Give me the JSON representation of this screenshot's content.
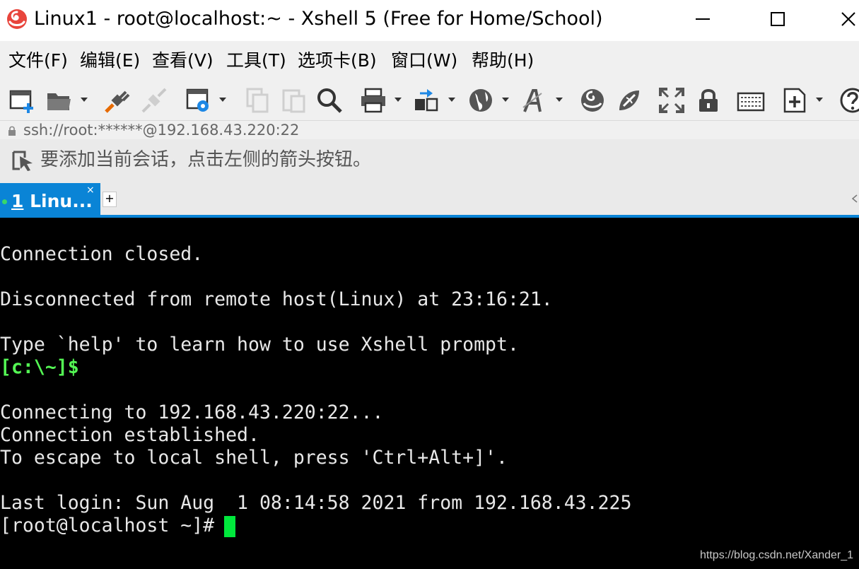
{
  "window": {
    "title": "Linux1 - root@localhost:~ - Xshell 5 (Free for Home/School)",
    "close_glyph": "✕"
  },
  "menu": {
    "items": [
      {
        "label": "文件(F)"
      },
      {
        "label": "编辑(E)"
      },
      {
        "label": "查看(V)"
      },
      {
        "label": "工具(T)"
      },
      {
        "label": "选项卡(B)"
      },
      {
        "label": "窗口(W)"
      },
      {
        "label": "帮助(H)"
      }
    ]
  },
  "toolbar": {
    "icons": [
      "new-session-icon",
      "open-folder-icon",
      "connect-icon",
      "disconnect-icon",
      "properties-icon",
      "copy-icon",
      "paste-icon",
      "find-icon",
      "print-icon",
      "transfer-icon",
      "globe-icon",
      "font-icon",
      "xshell-logo-icon",
      "xftp-icon",
      "fullscreen-icon",
      "lock-icon",
      "keyboard-icon",
      "compose-icon",
      "help-icon"
    ]
  },
  "address": {
    "value": "ssh://root:******@192.168.43.220:22"
  },
  "hint": {
    "text": "要添加当前会话，点击左侧的箭头按钮。"
  },
  "tabs": {
    "active": {
      "number": "1",
      "label": " Linu..."
    },
    "close_glyph": "×",
    "add_glyph": "+"
  },
  "terminal": {
    "lines": [
      {
        "text": ""
      },
      {
        "text": "Connection closed."
      },
      {
        "text": ""
      },
      {
        "text": "Disconnected from remote host(Linux) at 23:16:21."
      },
      {
        "text": ""
      },
      {
        "text": "Type `help' to learn how to use Xshell prompt."
      },
      {
        "text": "[c:\\~]$"
      },
      {
        "text": ""
      },
      {
        "text": "Connecting to 192.168.43.220:22..."
      },
      {
        "text": "Connection established."
      },
      {
        "text": "To escape to local shell, press 'Ctrl+Alt+]'."
      },
      {
        "text": ""
      },
      {
        "text": "Last login: Sun Aug  1 08:14:58 2021 from 192.168.43.225"
      },
      {
        "text": "[root@localhost ~]# "
      }
    ],
    "colors": {
      "background": "#000000",
      "text": "#e8e8e8",
      "local_prompt": "#54f754",
      "cursor": "#00e83c"
    }
  },
  "watermark": {
    "text": "https://blog.csdn.net/Xander_1"
  },
  "colors": {
    "accent": "#0a84d6",
    "chrome": "#f0f0f0"
  }
}
